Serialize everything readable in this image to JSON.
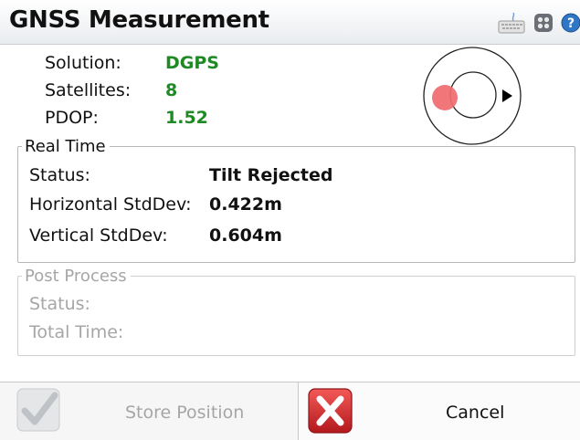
{
  "header": {
    "title": "GNSS Measurement",
    "icons": [
      "keyboard-icon",
      "options-icon",
      "help-icon"
    ]
  },
  "solution_info": {
    "solution_label": "Solution:",
    "solution_value": "DGPS",
    "satellites_label": "Satellites:",
    "satellites_value": "8",
    "pdop_label": "PDOP:",
    "pdop_value": "1.52",
    "value_color": "#1f8a24"
  },
  "real_time": {
    "title": "Real Time",
    "status_label": "Status:",
    "status_value": "Tilt Rejected",
    "hstd_label": "Horizontal StdDev:",
    "hstd_value": "0.422m",
    "vstd_label": "Vertical StdDev:",
    "vstd_value": "0.604m"
  },
  "post_process": {
    "title": "Post Process",
    "status_label": "Status:",
    "total_time_label": "Total Time:",
    "disabled_color": "#a6a6a6"
  },
  "buttons": {
    "store_label": "Store Position",
    "store_enabled": false,
    "cancel_label": "Cancel"
  },
  "colors": {
    "accent_green": "#1f8a24",
    "tilt_bubble": "#f06a6f",
    "cancel_red": "#d9242b"
  }
}
